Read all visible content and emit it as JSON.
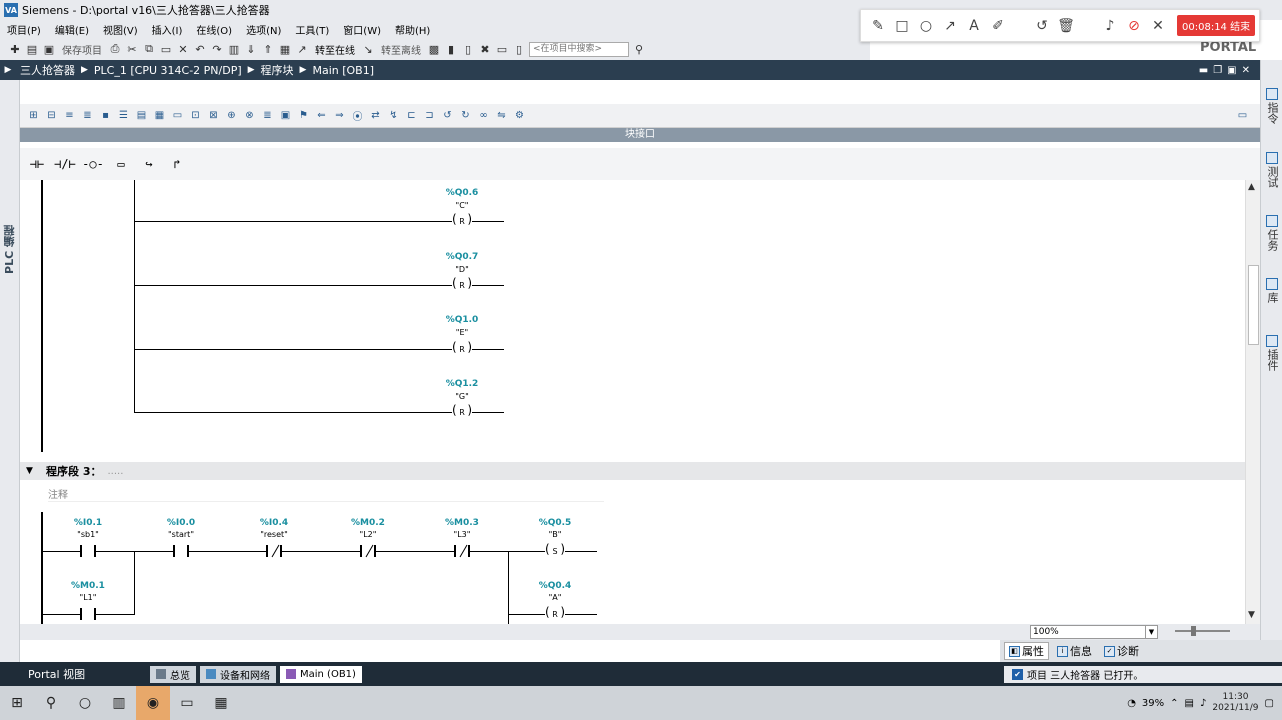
{
  "window": {
    "title": "Siemens - D:\\portal v16\\三人抢答器\\三人抢答器"
  },
  "menu": [
    "项目(P)",
    "编辑(E)",
    "视图(V)",
    "插入(I)",
    "在线(O)",
    "选项(N)",
    "工具(T)",
    "窗口(W)",
    "帮助(H)"
  ],
  "toolbar": {
    "save_label": "保存项目",
    "online_label": "转至在线",
    "offline_label": "转至离线",
    "search_placeholder": "<在项目中搜索>",
    "brand": "PORTAL"
  },
  "annotation": {
    "timer": "00:08:14 结束"
  },
  "breadcrumb": [
    "三人抢答器",
    "PLC_1 [CPU 314C-2 PN/DP]",
    "程序块",
    "Main [OB1]"
  ],
  "left_panel": {
    "label": "PLC 编程"
  },
  "right_panel": {
    "tabs": [
      "指令",
      "测试",
      "任务",
      "库",
      "插件"
    ]
  },
  "block_interface": {
    "label": "块接口"
  },
  "network2": {
    "coils": [
      {
        "address": "%Q0.6",
        "symbol": "\"C\"",
        "type": "R"
      },
      {
        "address": "%Q0.7",
        "symbol": "\"D\"",
        "type": "R"
      },
      {
        "address": "%Q1.0",
        "symbol": "\"E\"",
        "type": "R"
      },
      {
        "address": "%Q1.2",
        "symbol": "\"G\"",
        "type": "R"
      }
    ]
  },
  "network3": {
    "title": "程序段 3：",
    "title_comment": ".....",
    "comment": "注释",
    "contacts": [
      {
        "address": "%I0.1",
        "symbol": "\"sb1\"",
        "kind": "NO"
      },
      {
        "address": "%I0.0",
        "symbol": "\"start\"",
        "kind": "NO"
      },
      {
        "address": "%I0.4",
        "symbol": "\"reset\"",
        "kind": "NC"
      },
      {
        "address": "%M0.2",
        "symbol": "\"L2\"",
        "kind": "NC"
      },
      {
        "address": "%M0.3",
        "symbol": "\"L3\"",
        "kind": "NC"
      }
    ],
    "parallel_contact": {
      "address": "%M0.1",
      "symbol": "\"L1\"",
      "kind": "NO"
    },
    "coils": [
      {
        "address": "%Q0.5",
        "symbol": "\"B\"",
        "type": "S"
      },
      {
        "address": "%Q0.4",
        "symbol": "\"A\"",
        "type": "R"
      }
    ]
  },
  "status": {
    "zoom": "100%"
  },
  "properties_tabs": [
    "属性",
    "信息",
    "诊断"
  ],
  "portal_bar": {
    "portal_view": "Portal 视图",
    "editors": [
      "总览",
      "设备和网络",
      "Main (OB1)"
    ],
    "message": "项目 三人抢答器 已打开。"
  },
  "taskbar": {
    "battery": "39%",
    "time": "11:30",
    "date": "2021/11/9"
  }
}
